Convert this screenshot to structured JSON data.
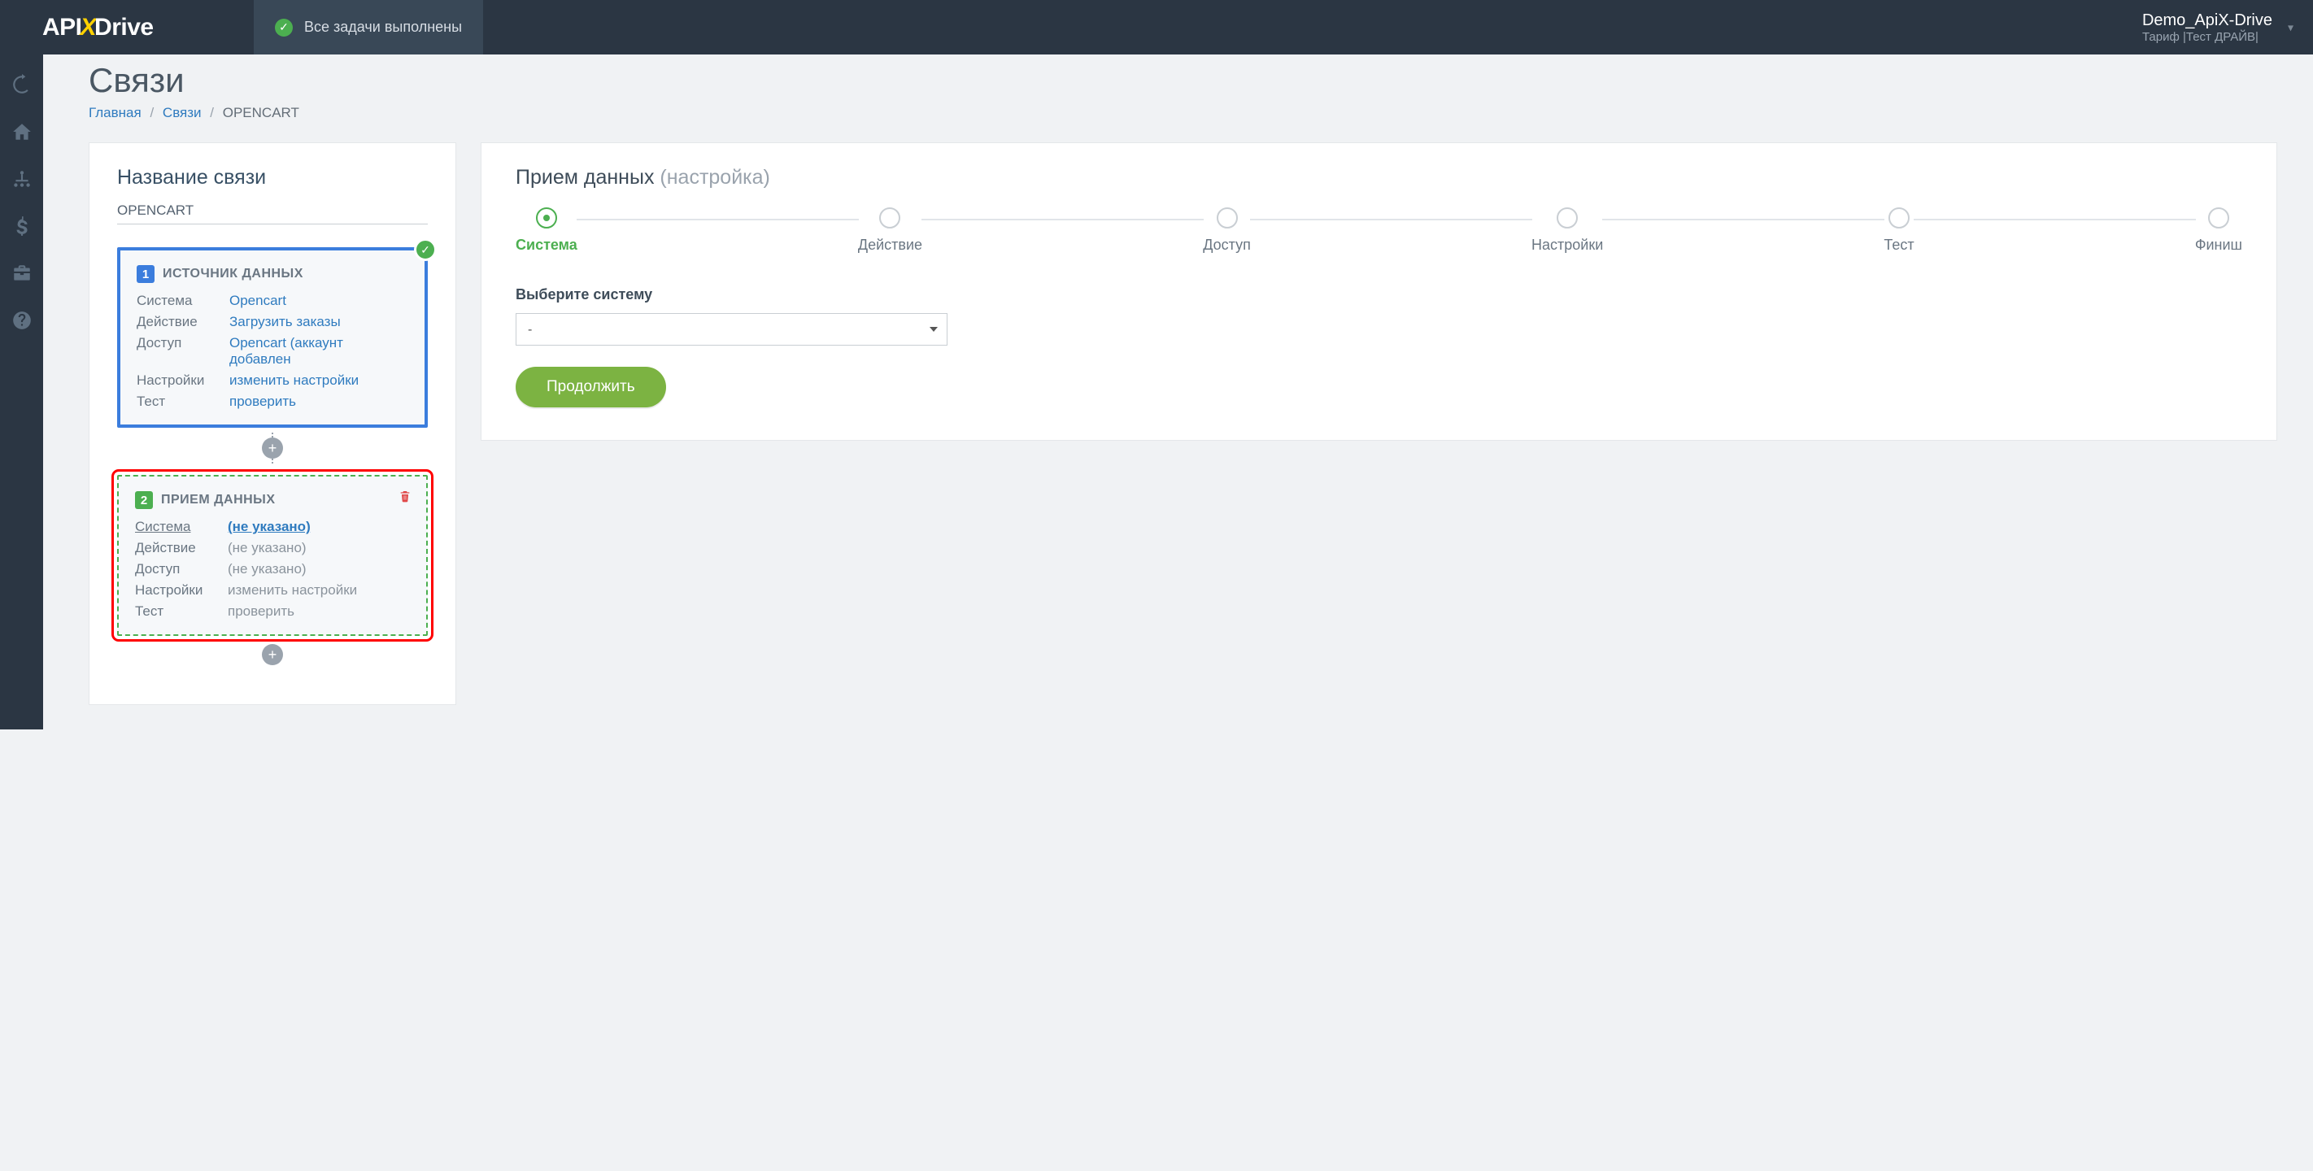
{
  "logo": {
    "api": "API",
    "x": "X",
    "drive": "Drive"
  },
  "topbar": {
    "status_text": "Все задачи выполнены"
  },
  "account": {
    "name": "Demo_ApiX-Drive",
    "tariff": "Тариф |Тест ДРАЙВ|"
  },
  "page": {
    "title": "Связи"
  },
  "breadcrumbs": {
    "home": "Главная",
    "connections": "Связи",
    "current": "OPENCART"
  },
  "left_panel": {
    "heading": "Название связи",
    "connection_name": "OPENCART",
    "source": {
      "number": "1",
      "title": "ИСТОЧНИК ДАННЫХ",
      "rows": {
        "system_label": "Система",
        "system_value": "Opencart",
        "action_label": "Действие",
        "action_value": "Загрузить заказы",
        "access_label": "Доступ",
        "access_value": "Opencart (аккаунт добавлен",
        "settings_label": "Настройки",
        "settings_value": "изменить настройки",
        "test_label": "Тест",
        "test_value": "проверить"
      }
    },
    "dest": {
      "number": "2",
      "title": "ПРИЕМ ДАННЫХ",
      "rows": {
        "system_label": "Система",
        "system_value": "(не указано)",
        "action_label": "Действие",
        "action_value": "(не указано)",
        "access_label": "Доступ",
        "access_value": "(не указано)",
        "settings_label": "Настройки",
        "settings_value": "изменить настройки",
        "test_label": "Тест",
        "test_value": "проверить"
      }
    },
    "add": "+"
  },
  "right_panel": {
    "heading": "Прием данных",
    "heading_sub": "(настройка)",
    "steps": {
      "system": "Система",
      "action": "Действие",
      "access": "Доступ",
      "settings": "Настройки",
      "test": "Тест",
      "finish": "Финиш"
    },
    "form": {
      "select_label": "Выберите систему",
      "select_value": "-",
      "continue": "Продолжить"
    }
  }
}
